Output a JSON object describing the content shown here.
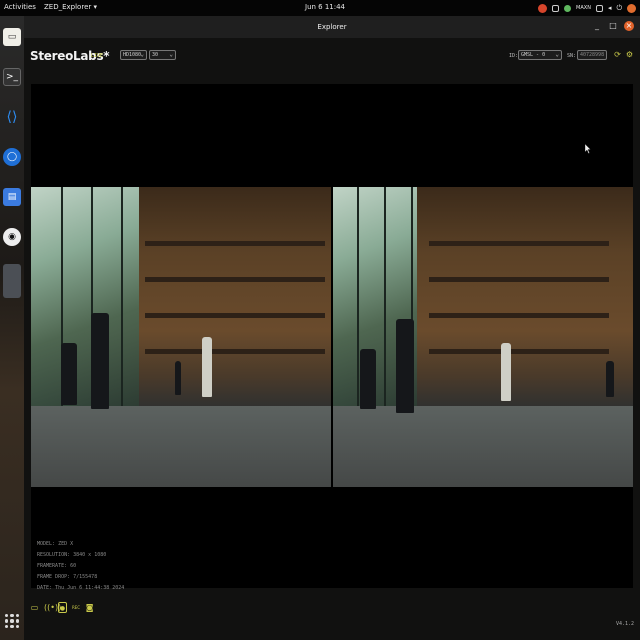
{
  "topbar": {
    "activities": "Activities",
    "app_menu": "ZED_Explorer ▾",
    "clock": "Jun 6  11:44",
    "tray_label": "MAXN",
    "tray_icons": [
      "app-indicator-icon",
      "status-icon",
      "network-icon",
      "volume-icon",
      "power-icon",
      "user-icon"
    ]
  },
  "dock": {
    "items": [
      "files-icon",
      "terminal-icon",
      "vscode-icon",
      "chromium-icon",
      "editor-icon",
      "obs-icon",
      "app-icon"
    ],
    "show_apps": "show-apps-icon"
  },
  "window": {
    "title": "Explorer",
    "controls": [
      "_",
      "□",
      "×"
    ]
  },
  "header": {
    "logo": "StereoLabs*",
    "live": "LIVE",
    "resolution": "HD1080",
    "fps": "30",
    "id_label": "ID:",
    "id_value": "GMSL - 0",
    "sn_label": "SN:",
    "sn_value": "40728998"
  },
  "info": {
    "model": "MODEL: ZED X",
    "resolution": "RESOLUTION: 3840 x 1080",
    "framerate": "FRAMERATE: 60",
    "frame_drop": "FRAME DROP: 7/155478",
    "date": "DATE: Thu Jun 6 11:44:38 2024"
  },
  "footer": {
    "icons": [
      "folder-icon",
      "stream-icon",
      "record-icon",
      "rec-label",
      "camera-icon"
    ],
    "rec_label": "REC",
    "version": "V4.1.2"
  },
  "colors": {
    "accent": "#c9c94a",
    "live": "#b5b82a",
    "close": "#e0622a"
  }
}
